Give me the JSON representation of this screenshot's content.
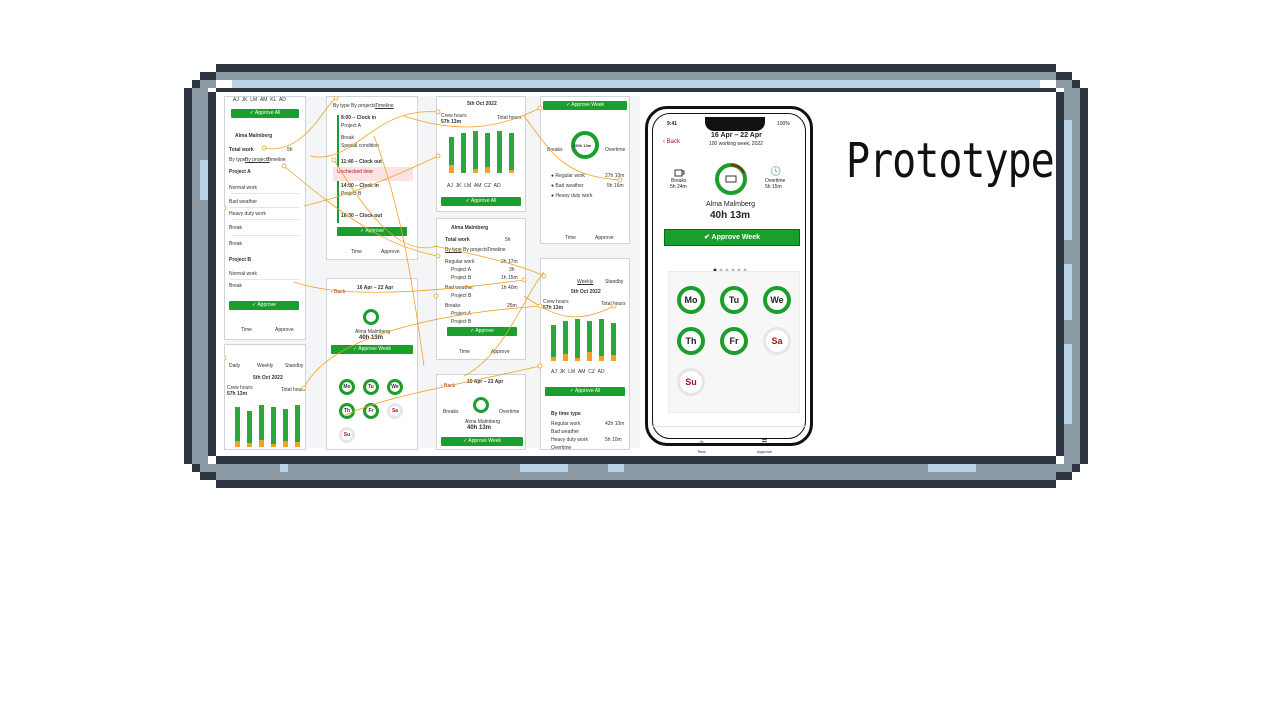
{
  "title": "Prototype",
  "phone": {
    "status_time": "9:41",
    "battery": "100%",
    "back_label": "Back",
    "date_range": "16 Apr – 22 Apr",
    "subtitle": "100 working week, 2022",
    "breaks_label": "Breaks",
    "breaks_value": "5h 24m",
    "overtime_label": "Overtime",
    "overtime_value": "5h 15m",
    "person_name": "Alma Malmberg",
    "total_hours": "40h 13m",
    "approve_label": "Approve Week",
    "days": [
      {
        "label": "Mo",
        "worked": true
      },
      {
        "label": "Tu",
        "worked": true
      },
      {
        "label": "We",
        "worked": true
      },
      {
        "label": "Th",
        "worked": true
      },
      {
        "label": "Fr",
        "worked": true
      },
      {
        "label": "Sa",
        "worked": false
      },
      {
        "label": "Su",
        "worked": false
      }
    ],
    "tab_time": "Time",
    "tab_approve": "Approve"
  },
  "collage": {
    "approve_all": "Approve All",
    "approve": "Approve",
    "approve_week": "Approve Week",
    "person": "Alma Malmberg",
    "total_work": "Total work",
    "total_work_value": "5h",
    "filter_type": "By type",
    "filter_projects": "By projects",
    "filter_timeline": "Timeline",
    "tab_daily": "Daily",
    "tab_weekly": "Weekly",
    "tab_standby": "Standby",
    "date_oct": "5th Oct 2022",
    "crew_hours": "Crew hours",
    "crew_value": "57h 13m",
    "total_hours": "Total hours",
    "clock_in": "8:00 – Clock in",
    "clock_out": "11:40 – Clock out",
    "clock_in2": "14:00 – Clock in",
    "clock_out2": "16:30 – Clock out",
    "unchecked": "Unchecked time",
    "project_a": "Project A",
    "project_b": "Project B",
    "break": "Break",
    "special": "Special condition",
    "regular_work": "Regular work",
    "bad_weather": "Bad weather",
    "heavy_duty": "Heavy duty work",
    "overtime": "Overtime",
    "normal_work": "Normal work",
    "breaks": "Breaks",
    "by_time_type": "By time type",
    "week_range": "16 Apr – 22 Apr",
    "total_mid": "40h 13m",
    "ring_value": "250h 13m",
    "time": "Time",
    "approve_tab": "Approve",
    "crew": [
      "AJ",
      "JK",
      "LM",
      "AM",
      "CZ",
      "AD"
    ],
    "days_short": [
      "Mo",
      "Tu",
      "We",
      "Th",
      "Fr",
      "Sa",
      "Su"
    ],
    "val_2h17": "2h 17m",
    "val_1h15": "1h 15m",
    "val_25m": "25m",
    "val_1h40": "1h 40m",
    "val_5h10": "5h 10m",
    "val_3h": "3h",
    "val_27h": "27h 10m",
    "val_5h16": "5h 16m",
    "val_42h": "42h 10m"
  },
  "colors": {
    "accent": "#1a9e2c",
    "orange": "#f0a322",
    "red": "#a01818"
  }
}
